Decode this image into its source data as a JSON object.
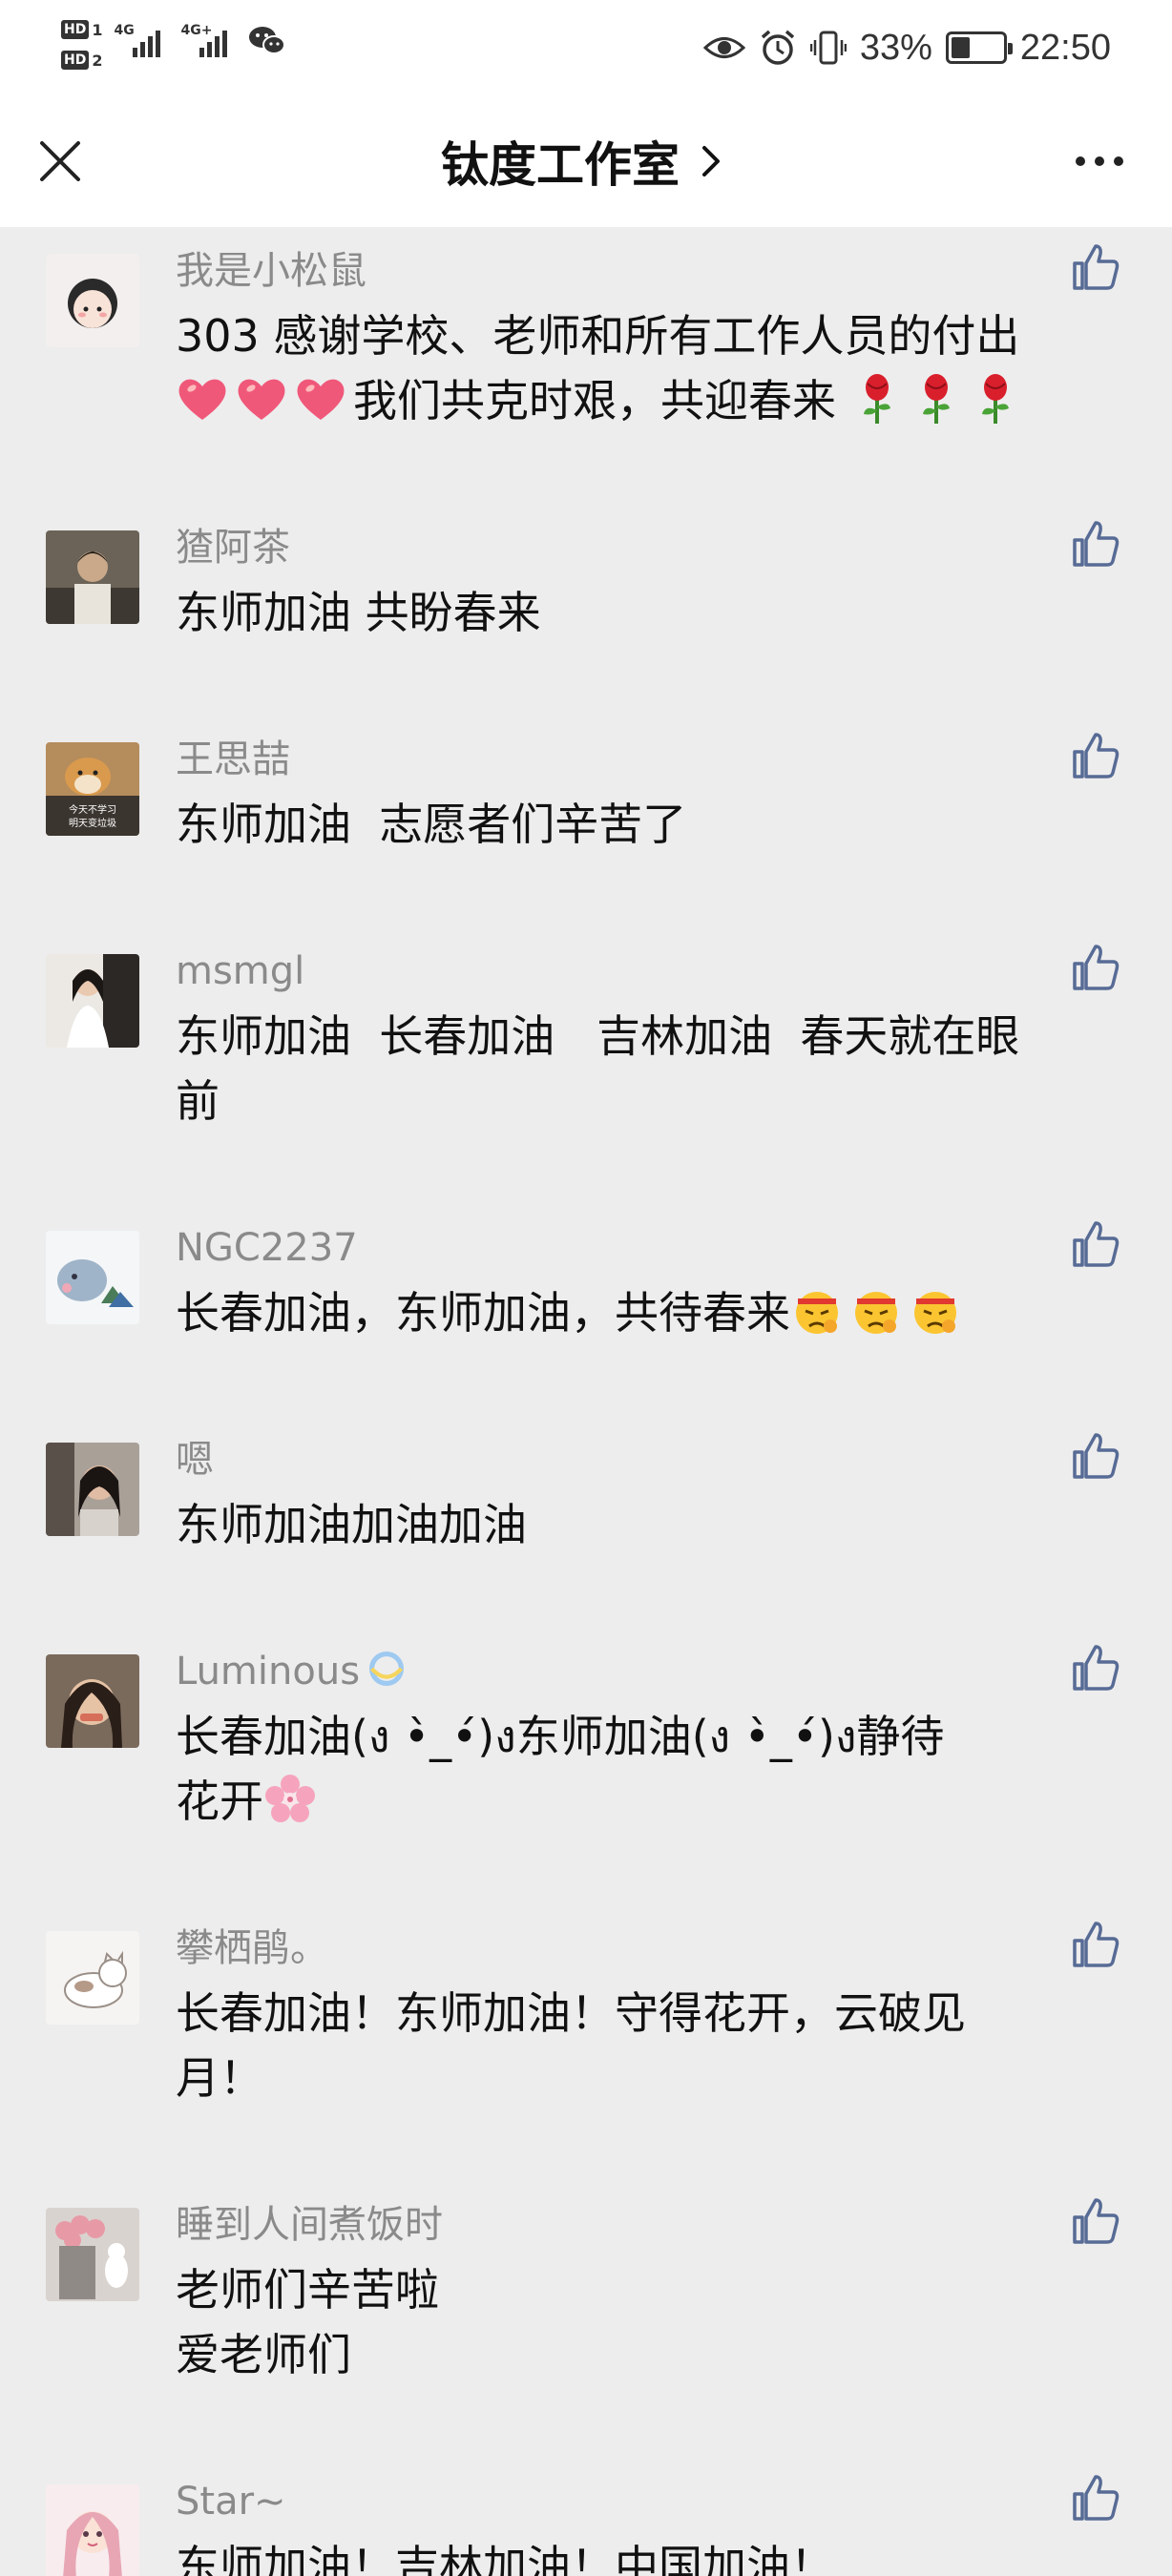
{
  "status_bar": {
    "sim1": "HD",
    "sim1_num": "1",
    "sim2": "HD",
    "sim2_num": "2",
    "net1": "4G",
    "net2": "4G+",
    "battery_percent": "33%",
    "battery_level": 0.33,
    "time": "22:50",
    "icons": [
      "eye-icon",
      "alarm-icon",
      "vibrate-icon",
      "battery-icon",
      "wechat-icon",
      "signal-icon"
    ]
  },
  "nav": {
    "title": "钛度工作室",
    "close_icon": "close-icon",
    "more_icon": "more-icon"
  },
  "comments": [
    {
      "name": "我是小松鼠",
      "lines": [
        "303 感谢学校、老师和所有工作人员的付出",
        "我们共克时艰，共迎春来"
      ],
      "emojis": [
        "heart",
        "heart",
        "heart",
        "rose",
        "rose",
        "rose"
      ]
    },
    {
      "name": "猹阿茶",
      "lines": [
        "东师加油 共盼春来"
      ]
    },
    {
      "name": "王思喆",
      "lines": [
        "东师加油  志愿者们辛苦了"
      ],
      "avatar_text": [
        "今天不学习",
        "明天变垃圾"
      ]
    },
    {
      "name": "msmgl",
      "lines": [
        "东师加油  长春加油   吉林加油  春天就在眼",
        "前"
      ]
    },
    {
      "name": "NGC2237",
      "lines": [
        "长春加油，东师加油，共待春来"
      ],
      "emojis": [
        "fighting",
        "fighting",
        "fighting"
      ]
    },
    {
      "name": "嗯",
      "lines": [
        "东师加油加油加油"
      ]
    },
    {
      "name": "Luminous",
      "lines": [
        "长春加油(ง •̀_•́)ง东师加油(ง •̀_•́)ง静待",
        "花开"
      ],
      "emojis": [
        "blossom"
      ],
      "name_emoji": "dizzy"
    },
    {
      "name": "攀栖鹃。",
      "lines": [
        "长春加油！东师加油！守得花开，云破见",
        "月！"
      ]
    },
    {
      "name": "睡到人间煮饭时",
      "lines": [
        "老师们辛苦啦",
        "爱老师们"
      ]
    },
    {
      "name": "Star~",
      "lines": [
        "东师加油！吉林加油！中国加油！"
      ]
    }
  ],
  "colors": {
    "background": "#ededed",
    "header": "#ffffff",
    "name_gray": "#8a8a8a",
    "like_blue": "#576b95"
  }
}
